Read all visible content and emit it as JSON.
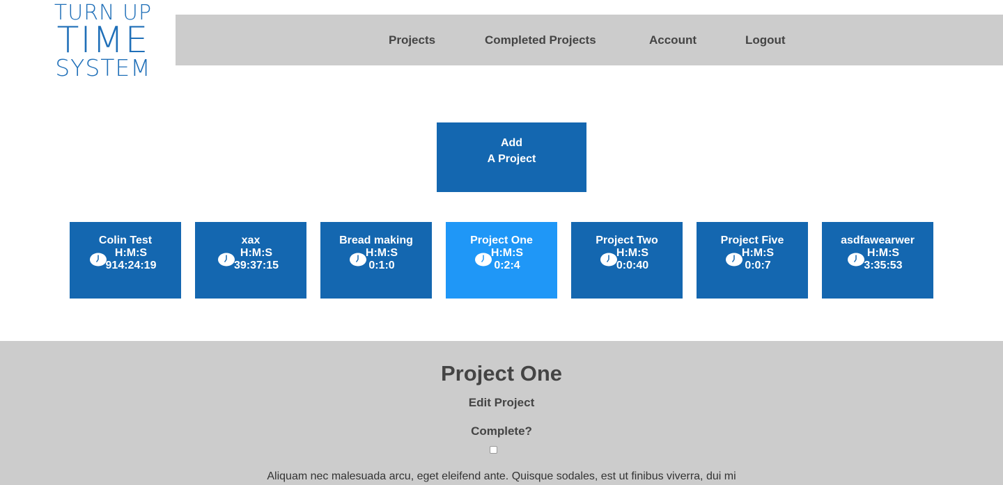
{
  "logo": {
    "line1": "TURN UP",
    "line2": "TIME",
    "line3": "SYSTEM",
    "color": "#1f6fb8"
  },
  "nav": {
    "items": [
      {
        "label": "Projects"
      },
      {
        "label": "Completed Projects"
      },
      {
        "label": "Account"
      },
      {
        "label": "Logout"
      }
    ]
  },
  "add_project": {
    "line1": "Add",
    "line2": "A Project"
  },
  "projects": [
    {
      "name": "Colin Test",
      "units": "H:M:S",
      "time": "914:24:19",
      "active": false
    },
    {
      "name": "xax",
      "units": "H:M:S",
      "time": "39:37:15",
      "active": false
    },
    {
      "name": "Bread making",
      "units": "H:M:S",
      "time": "0:1:0",
      "active": false
    },
    {
      "name": "Project One",
      "units": "H:M:S",
      "time": "0:2:4",
      "active": true
    },
    {
      "name": "Project Two",
      "units": "H:M:S",
      "time": "0:0:40",
      "active": false
    },
    {
      "name": "Project Five",
      "units": "H:M:S",
      "time": "0:0:7",
      "active": false
    },
    {
      "name": "asdfawearwer",
      "units": "H:M:S",
      "time": "3:35:53",
      "active": false
    }
  ],
  "detail": {
    "title": "Project One",
    "edit_label": "Edit Project",
    "complete_label": "Complete?",
    "complete_checked": false,
    "description": "Aliquam nec malesuada arcu, eget eleifend ante. Quisque sodales, est ut finibus viverra, dui mi"
  },
  "colors": {
    "card": "#1467b0",
    "card_active": "#1f97f7",
    "nav_bg": "#cccccc",
    "text_dark": "#444444"
  }
}
